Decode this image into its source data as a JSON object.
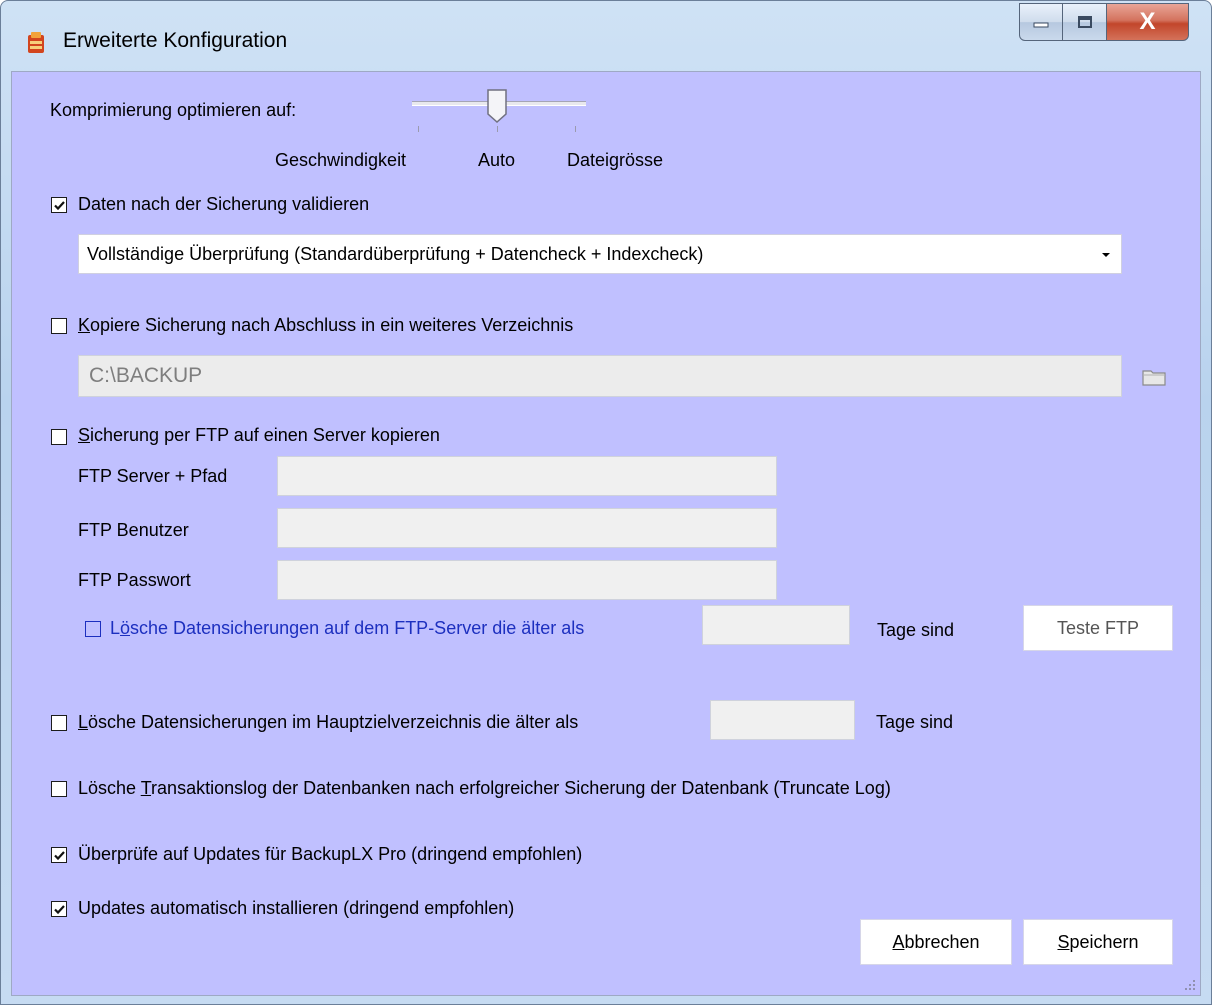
{
  "window": {
    "title": "Erweiterte Konfiguration",
    "close_glyph": "X",
    "icon": "backup-app-icon"
  },
  "compression": {
    "label": "Komprimierung optimieren auf:",
    "options": [
      "Geschwindigkeit",
      "Auto",
      "Dateigrösse"
    ],
    "selected": "Auto"
  },
  "validate": {
    "label": "Daten nach der Sicherung validieren",
    "checked": true,
    "mode": "Vollständige Überprüfung (Standardüberprüfung + Datencheck + Indexcheck)"
  },
  "copy": {
    "label_underline": "K",
    "label_rest": "opiere Sicherung nach Abschluss in ein weiteres Verzeichnis",
    "checked": false,
    "path": "C:\\BACKUP",
    "browse_icon": "folder-icon"
  },
  "ftp": {
    "label_underline": "S",
    "label_rest": "icherung per FTP auf einen Server kopieren",
    "checked": false,
    "server_label": "FTP Server + Pfad",
    "server_value": "",
    "user_label": "FTP Benutzer",
    "user_value": "",
    "password_label": "FTP Passwort",
    "password_value": "",
    "delete_prefix": "L",
    "delete_underline": "ö",
    "delete_rest": "sche Datensicherungen auf dem FTP-Server die älter als",
    "delete_checked": false,
    "delete_days": "",
    "delete_suffix": "Tage sind",
    "test_button": "Teste FTP"
  },
  "delete_main": {
    "label_underline": "L",
    "label_rest": "ösche Datensicherungen im Hauptzielverzeichnis die älter als",
    "checked": false,
    "days": "",
    "suffix": "Tage sind"
  },
  "truncate": {
    "prefix": "Lösche ",
    "underline": "T",
    "rest": "ransaktionslog der Datenbanken nach erfolgreicher Sicherung der Datenbank (Truncate Log)",
    "checked": false
  },
  "check_updates": {
    "label": "Überprüfe auf Updates für BackupLX Pro (dringend empfohlen)",
    "checked": true
  },
  "auto_install": {
    "label": "Updates automatisch installieren (dringend empfohlen)",
    "checked": true
  },
  "buttons": {
    "cancel_underline": "A",
    "cancel_rest": "bbrechen",
    "save_underline": "S",
    "save_rest": "peichern"
  },
  "colors": {
    "client_bg": "#c0c0ff",
    "link_blue": "#1c2fbf"
  }
}
